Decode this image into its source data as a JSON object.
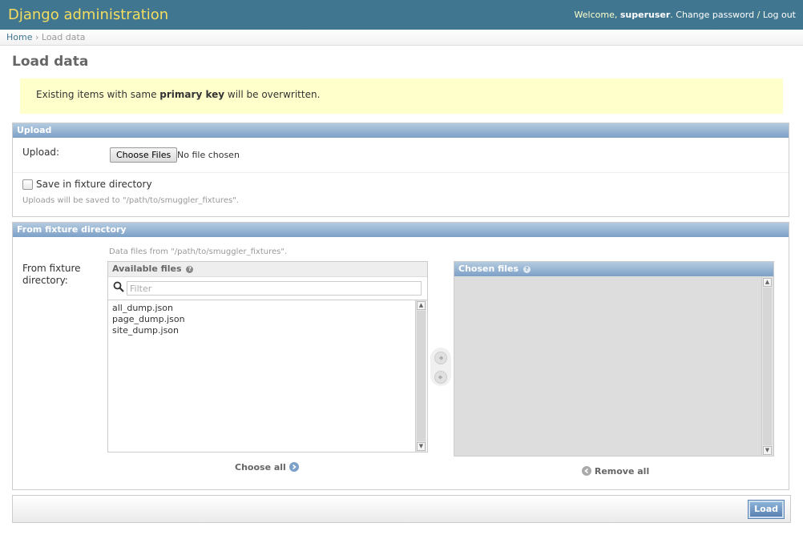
{
  "header": {
    "site_title": "Django administration",
    "welcome": "Welcome,",
    "username": "superuser",
    "change_password": "Change password",
    "separator": "/",
    "logout": "Log out"
  },
  "breadcrumbs": {
    "home": "Home",
    "sep": "›",
    "current": "Load data"
  },
  "page_title": "Load data",
  "notice": {
    "before": "Existing items with same ",
    "bold": "primary key",
    "after": " will be overwritten."
  },
  "upload": {
    "heading": "Upload",
    "label": "Upload:",
    "button": "Choose Files",
    "status": "No file chosen",
    "save_label": "Save in fixture directory",
    "help": "Uploads will be saved to \"/path/to/smuggler_fixtures\"."
  },
  "fixture": {
    "heading": "From fixture directory",
    "help": "Data files from \"/path/to/smuggler_fixtures\".",
    "label_line1": "From fixture",
    "label_line2": "directory:",
    "available_title": "Available files",
    "chosen_title": "Chosen files",
    "filter_placeholder": "Filter",
    "files": [
      "all_dump.json",
      "page_dump.json",
      "site_dump.json"
    ],
    "choose_all": "Choose all",
    "remove_all": "Remove all"
  },
  "submit": {
    "load": "Load"
  },
  "colors": {
    "header_bg": "#417690",
    "title_yellow": "#f5dd5d",
    "notice_bg": "#ffffcc",
    "module_head": "#7ca0c7"
  }
}
